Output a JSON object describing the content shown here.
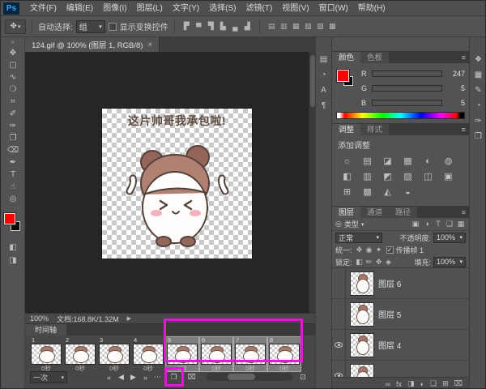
{
  "app": {
    "logo_text": "Ps",
    "accent_magenta": "#e715d8",
    "foreground_color": "#f70505"
  },
  "menu_bar": {
    "items": [
      "文件(F)",
      "编辑(E)",
      "图像(I)",
      "图层(L)",
      "文字(Y)",
      "选择(S)",
      "滤镜(T)",
      "视图(V)",
      "窗口(W)",
      "帮助(H)"
    ]
  },
  "options_bar": {
    "tool_glyph": "✥",
    "dropdown_glyph": "▾",
    "auto_select_label": "自动选择:",
    "auto_select_value": "组",
    "show_transform_label": "显示变换控件",
    "align_icons": [
      "▛",
      "▀",
      "▜",
      "▙",
      "▄",
      "▟"
    ],
    "distribute_icons": [
      "▤",
      "▥",
      "▦",
      "▧",
      "▨",
      "▩"
    ]
  },
  "document_tab": {
    "title": "124.gif @ 100% (图层 1, RGB/8)",
    "close_glyph": "×"
  },
  "toolbar": {
    "collapse_glyph": "»",
    "tools": [
      {
        "name": "move-tool",
        "glyph": "✥"
      },
      {
        "name": "rectangular-marquee-tool",
        "glyph": "▢"
      },
      {
        "name": "lasso-tool",
        "glyph": "∿"
      },
      {
        "name": "quick-selection-tool",
        "glyph": "❍"
      },
      {
        "name": "crop-tool",
        "glyph": "⌗"
      },
      {
        "name": "eyedropper-tool",
        "glyph": "✐"
      },
      {
        "name": "brush-tool",
        "glyph": "✑"
      },
      {
        "name": "clone-stamp-tool",
        "glyph": "❒"
      },
      {
        "name": "eraser-tool",
        "glyph": "⌫"
      },
      {
        "name": "pen-tool",
        "glyph": "✒"
      },
      {
        "name": "type-tool",
        "glyph": "T"
      },
      {
        "name": "hand-tool",
        "glyph": "☝"
      },
      {
        "name": "zoom-tool",
        "glyph": "◎"
      }
    ],
    "quick_mask_glyph": "◧",
    "screen_mode_glyph": "◨"
  },
  "canvas": {
    "caption": "这片帅哥我承包啦!"
  },
  "status_bar": {
    "zoom": "100%",
    "doc_info": "文档:168.8K/1.32M",
    "play_glyph": "▶"
  },
  "timeline": {
    "tab_label": "时间轴",
    "loop_value": "一次",
    "dropdown_glyph": "▾",
    "frames": [
      {
        "num": "1",
        "delay": "0秒",
        "selected": false
      },
      {
        "num": "2",
        "delay": "0秒",
        "selected": false
      },
      {
        "num": "3",
        "delay": "0秒",
        "selected": false
      },
      {
        "num": "4",
        "delay": "0秒",
        "selected": false
      },
      {
        "num": "5",
        "delay": "0秒",
        "selected": true
      },
      {
        "num": "6",
        "delay": "0秒",
        "selected": true
      },
      {
        "num": "7",
        "delay": "0秒",
        "selected": true
      },
      {
        "num": "8",
        "delay": "0秒",
        "selected": true
      }
    ],
    "buttons": [
      {
        "name": "first-frame-button",
        "glyph": "«"
      },
      {
        "name": "previous-frame-button",
        "glyph": "◀"
      },
      {
        "name": "play-button",
        "glyph": "▶"
      },
      {
        "name": "next-frame-button",
        "glyph": "»"
      },
      {
        "name": "tween-button",
        "glyph": "⋯"
      }
    ],
    "duplicate_frame_glyph": "❐",
    "delete_frame_glyph": "⌧",
    "convert_glyph": "⊡",
    "scroll_left_glyph": "◂",
    "scroll_right_glyph": "▸"
  },
  "color_panel": {
    "tabs": [
      {
        "label": "颜色",
        "active": true
      },
      {
        "label": "色板",
        "active": false
      }
    ],
    "menu_glyph": "≡",
    "channels": [
      {
        "label": "R",
        "value": "247"
      },
      {
        "label": "G",
        "value": "5"
      },
      {
        "label": "B",
        "value": "5"
      }
    ]
  },
  "adjustments_panel": {
    "tabs": [
      {
        "label": "调整",
        "active": true
      },
      {
        "label": "样式",
        "active": false
      }
    ],
    "menu_glyph": "≡",
    "hint": "添加调整",
    "icons": [
      "☼",
      "▤",
      "◪",
      "▦",
      "◐",
      "◍",
      "◧",
      "▥",
      "◩",
      "▨",
      "◫",
      "▣",
      "⊞",
      "▩",
      "◭",
      "◒"
    ]
  },
  "layers_panel": {
    "tabs": [
      {
        "label": "图层",
        "active": true
      },
      {
        "label": "通道",
        "active": false
      },
      {
        "label": "路径",
        "active": false
      }
    ],
    "menu_glyph": "≡",
    "filter": {
      "search_glyph": "◎",
      "label": "类型",
      "dropdown_glyph": "▾",
      "icons": [
        "▣",
        "◑",
        "T",
        "❏",
        "▦"
      ]
    },
    "blend_mode": "正常",
    "dropdown_glyph": "▾",
    "opacity_label": "不透明度:",
    "opacity_value": "100%",
    "unify_label": "统一:",
    "unify_icons": [
      "✥",
      "◉",
      "✦"
    ],
    "propagate_check": "✓",
    "propagate_label": "传播帧 1",
    "lock_label": "锁定:",
    "lock_icons": [
      "◧",
      "✏",
      "✥",
      "◈"
    ],
    "fill_label": "填充:",
    "fill_value": "100%",
    "layers": [
      {
        "name": "图层 6",
        "visible": false
      },
      {
        "name": "图层 5",
        "visible": false
      },
      {
        "name": "图层 4",
        "visible": true
      },
      {
        "name": "",
        "visible": true
      }
    ],
    "bottom_icons": [
      "∞",
      "fx",
      "◨",
      "◐",
      "❏",
      "⊞",
      "⌧"
    ]
  },
  "inner_dock_icons": [
    {
      "name": "info-panel-icon",
      "glyph": "▤"
    },
    {
      "name": "histogram-panel-icon",
      "glyph": "◔"
    },
    {
      "name": "character-panel-icon",
      "glyph": "A"
    },
    {
      "name": "paragraph-panel-icon",
      "glyph": "¶"
    }
  ],
  "outer_dock_icons": [
    {
      "name": "history-panel-icon",
      "glyph": "❖"
    },
    {
      "name": "properties-panel-icon",
      "glyph": "▦"
    },
    {
      "name": "actions-panel-icon",
      "glyph": "✎"
    },
    {
      "name": "navigator-panel-icon",
      "glyph": "◔"
    },
    {
      "name": "brush-panel-icon",
      "glyph": "✑"
    },
    {
      "name": "clone-source-panel-icon",
      "glyph": "❒"
    }
  ]
}
